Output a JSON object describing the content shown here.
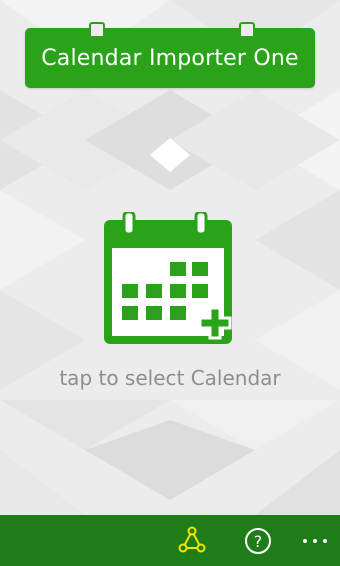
{
  "app": {
    "title": "Calendar Importer One"
  },
  "main": {
    "select_label": "tap to select Calendar",
    "calendar_icon": "calendar-add-icon"
  },
  "appbar": {
    "buttons": [
      {
        "icon": "share-icon"
      },
      {
        "icon": "help-icon",
        "glyph": "?"
      },
      {
        "icon": "more-icon",
        "glyph": "..."
      }
    ]
  },
  "colors": {
    "accent": "#2aa31a",
    "appbar": "#1e7d16",
    "share_icon": "#f2e600",
    "label": "#8e8e8e"
  }
}
